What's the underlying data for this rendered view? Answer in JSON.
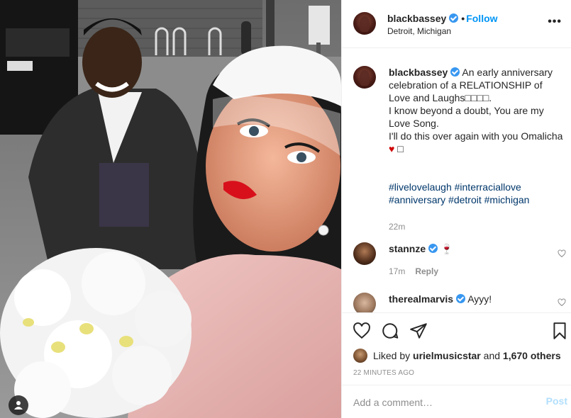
{
  "post": {
    "username": "blackbassey",
    "follow_label": "Follow",
    "separator": "•",
    "location": "Detroit, Michigan",
    "more_label": "•••"
  },
  "caption": {
    "username": "blackbassey",
    "line1": "An early anniversary celebration of a RELATIONSHIP of Love and Laughs□□□□.",
    "line2": "I know beyond a doubt, You are my Love Song.",
    "line3": "I'll do this over again with you Omalicha",
    "heart": "♥",
    "trailing": "□",
    "hashtags_line1": "#livelovelaugh #interraciallove",
    "hashtags_line2": "#anniversary #detroit #michigan",
    "time": "22m"
  },
  "comments": [
    {
      "username": "stannze",
      "text": "🍷",
      "time": "17m",
      "reply_label": "Reply"
    },
    {
      "username": "therealmarvis",
      "text": "Ayyy!"
    }
  ],
  "likes": {
    "prefix": "Liked by",
    "user": "urielmusicstar",
    "connector": "and",
    "count": "1,670 others"
  },
  "timestamp": "22 MINUTES AGO",
  "add_comment": {
    "placeholder": "Add a comment…",
    "post_label": "Post"
  },
  "colors": {
    "accent": "#0095f6",
    "hashtag": "#00376b",
    "muted": "#8e8e8e",
    "border": "#efefef"
  }
}
